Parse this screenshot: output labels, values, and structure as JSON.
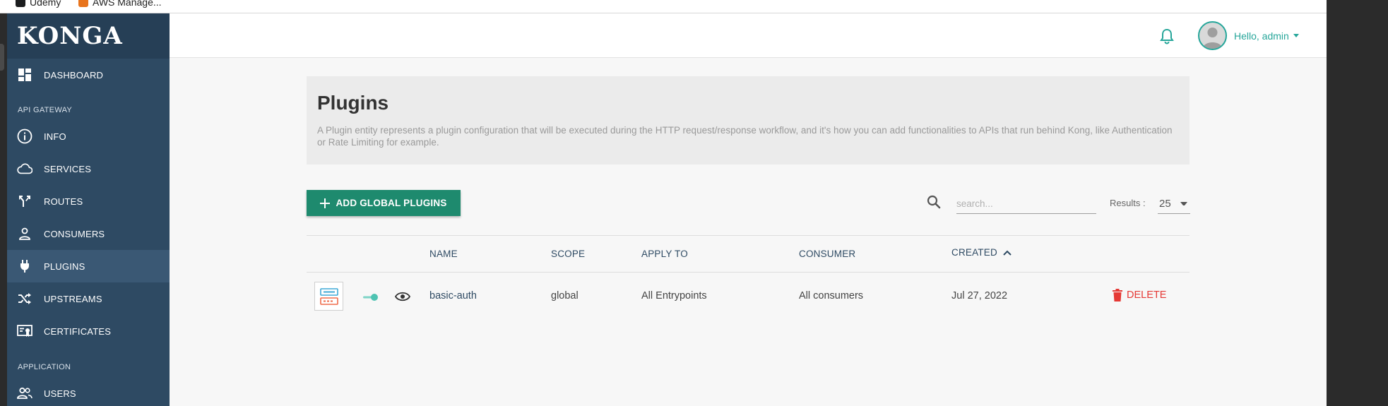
{
  "browser": {
    "bookmarks": [
      {
        "label": "Udemy",
        "icon": "udemy-icon",
        "color": "#1c1d1f"
      },
      {
        "label": "AWS Manage...",
        "icon": "aws-icon",
        "color": "#e8741c"
      }
    ]
  },
  "sidebar": {
    "brand": "KONGA",
    "dashboard_label": "DASHBOARD",
    "section_api": "API GATEWAY",
    "section_app": "APPLICATION",
    "items": [
      {
        "label": "INFO",
        "icon": "info-icon"
      },
      {
        "label": "SERVICES",
        "icon": "cloud-icon"
      },
      {
        "label": "ROUTES",
        "icon": "route-fork-icon"
      },
      {
        "label": "CONSUMERS",
        "icon": "person-icon"
      },
      {
        "label": "PLUGINS",
        "icon": "plug-icon",
        "active": true
      },
      {
        "label": "UPSTREAMS",
        "icon": "shuffle-icon"
      },
      {
        "label": "CERTIFICATES",
        "icon": "certificate-icon"
      },
      {
        "label": "USERS",
        "icon": "users-icon"
      }
    ]
  },
  "header": {
    "greeting": "Hello, admin"
  },
  "page": {
    "title": "Plugins",
    "description": "A Plugin entity represents a plugin configuration that will be executed during the HTTP request/response workflow, and it's how you can add functionalities to APIs that run behind Kong, like Authentication or Rate Limiting for example.",
    "add_button": "ADD GLOBAL PLUGINS",
    "search_placeholder": "search...",
    "results_label": "Results :",
    "results_value": "25"
  },
  "table": {
    "columns": {
      "name": "NAME",
      "scope": "SCOPE",
      "apply_to": "APPLY TO",
      "consumer": "CONSUMER",
      "created": "CREATED"
    },
    "rows": [
      {
        "name": "basic-auth",
        "scope": "global",
        "apply_to": "All Entrypoints",
        "consumer": "All consumers",
        "created": "Jul 27, 2022",
        "delete_label": "DELETE",
        "enabled": true
      }
    ]
  },
  "colors": {
    "accent": "#26a69a",
    "primary_button": "#1e8a6e",
    "sidebar": "#2e4a63",
    "danger": "#e53935"
  }
}
